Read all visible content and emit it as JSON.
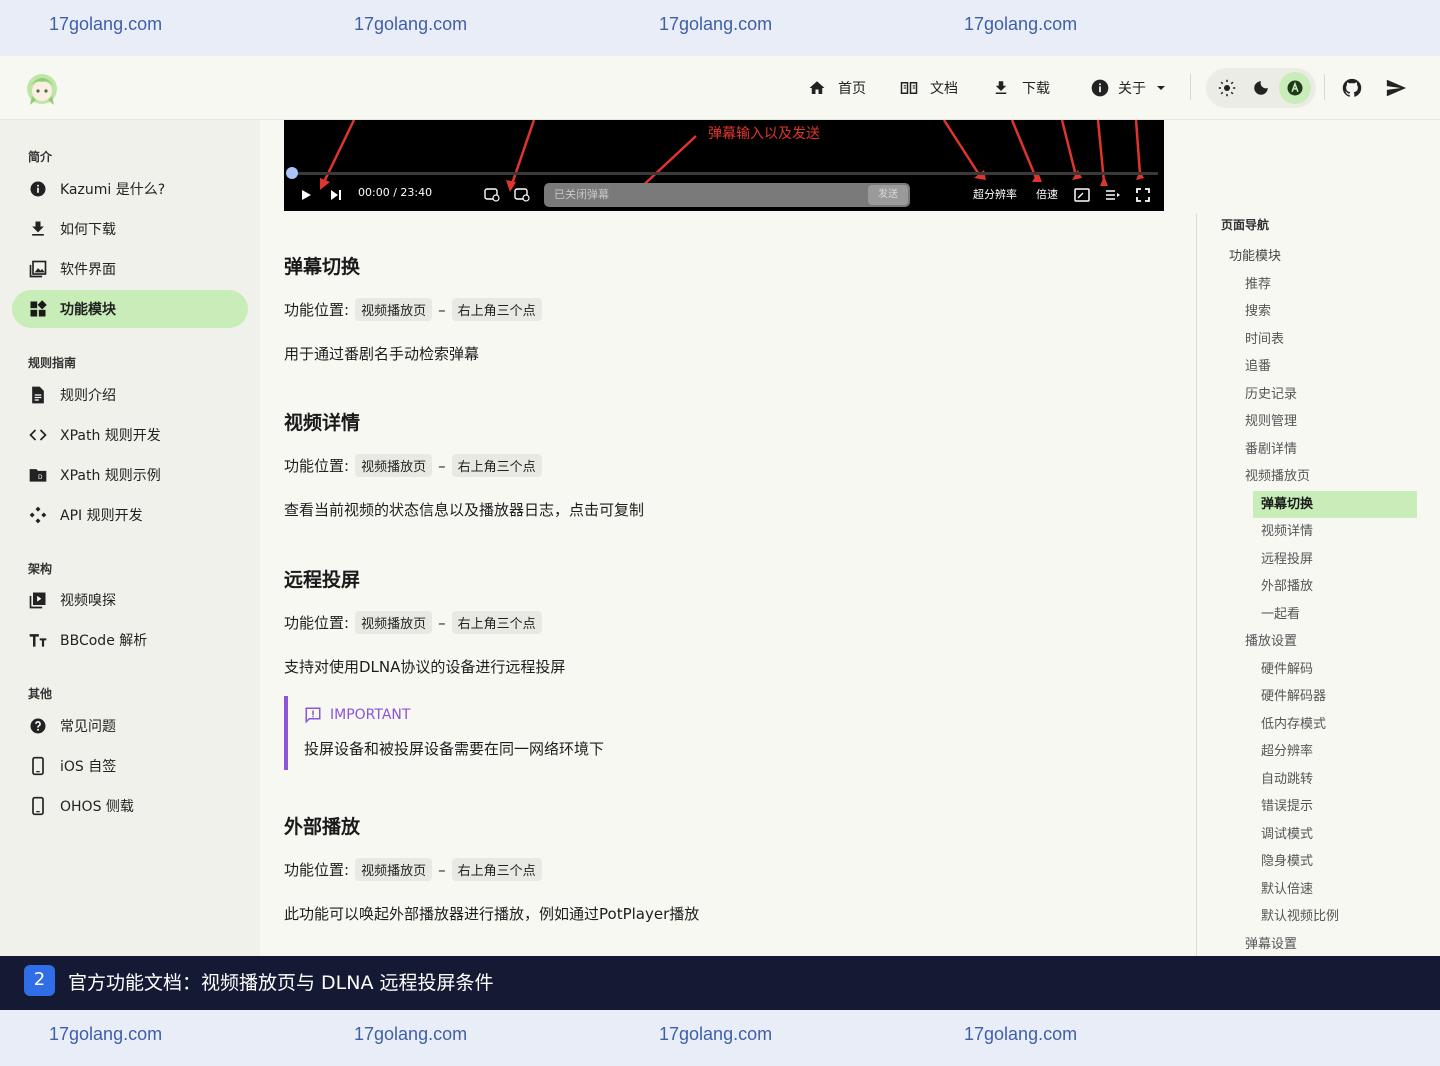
{
  "watermark": {
    "text": "17golang.com"
  },
  "header": {
    "nav": [
      {
        "label": "首页",
        "icon": "home-icon"
      },
      {
        "label": "文档",
        "icon": "book-icon"
      },
      {
        "label": "下载",
        "icon": "download-icon"
      },
      {
        "label": "关于",
        "icon": "info-icon"
      }
    ],
    "theme": {
      "active": "auto",
      "accent": "#c8edb8"
    }
  },
  "sidebar": {
    "sections": [
      {
        "title": "简介",
        "items": [
          {
            "label": "Kazumi 是什么?",
            "icon": "info-icon"
          },
          {
            "label": "如何下载",
            "icon": "download-icon"
          },
          {
            "label": "软件界面",
            "icon": "gallery-icon"
          },
          {
            "label": "功能模块",
            "icon": "widgets-icon",
            "active": true
          }
        ]
      },
      {
        "title": "规则指南",
        "items": [
          {
            "label": "规则介绍",
            "icon": "document-icon"
          },
          {
            "label": "XPath 规则开发",
            "icon": "code-icon"
          },
          {
            "label": "XPath 规则示例",
            "icon": "folder-icon"
          },
          {
            "label": "API 规则开发",
            "icon": "api-icon"
          }
        ]
      },
      {
        "title": "架构",
        "items": [
          {
            "label": "视频嗅探",
            "icon": "video-library-icon"
          },
          {
            "label": "BBCode 解析",
            "icon": "text-format-icon"
          }
        ]
      },
      {
        "title": "其他",
        "items": [
          {
            "label": "常见问题",
            "icon": "help-icon"
          },
          {
            "label": "iOS 自签",
            "icon": "phone-icon"
          },
          {
            "label": "OHOS 侧载",
            "icon": "phone-icon"
          }
        ]
      }
    ]
  },
  "player": {
    "caption": "弹幕输入以及发送",
    "time": "00:00 / 23:40",
    "danmaku_placeholder": "已关闭弹幕",
    "send_label": "发送",
    "super_resolution": "超分辨率",
    "speed": "倍速"
  },
  "content": {
    "location_label": "功能位置:",
    "location_path": [
      "视频播放页",
      "右上角三个点"
    ],
    "location_sep": "–",
    "sections": [
      {
        "heading": "弹幕切换",
        "desc": "用于通过番剧名手动检索弹幕"
      },
      {
        "heading": "视频详情",
        "desc": "查看当前视频的状态信息以及播放器日志，点击可复制"
      },
      {
        "heading": "远程投屏",
        "desc": "支持对使用DLNA协议的设备进行远程投屏"
      },
      {
        "heading": "外部播放",
        "desc": "此功能可以唤起外部播放器进行播放，例如通过PotPlayer播放"
      }
    ],
    "callout": {
      "title": "IMPORTANT",
      "body": "投屏设备和被投屏设备需要在同一网络环境下",
      "color": "#8a55d8"
    }
  },
  "toc": {
    "title": "页面导航",
    "items": [
      {
        "label": "功能模块",
        "level": 1
      },
      {
        "label": "推荐",
        "level": 2
      },
      {
        "label": "搜索",
        "level": 2
      },
      {
        "label": "时间表",
        "level": 2
      },
      {
        "label": "追番",
        "level": 2
      },
      {
        "label": "历史记录",
        "level": 2
      },
      {
        "label": "规则管理",
        "level": 2
      },
      {
        "label": "番剧详情",
        "level": 2
      },
      {
        "label": "视频播放页",
        "level": 2
      },
      {
        "label": "弹幕切换",
        "level": 3,
        "active": true
      },
      {
        "label": "视频详情",
        "level": 3
      },
      {
        "label": "远程投屏",
        "level": 3
      },
      {
        "label": "外部播放",
        "level": 3
      },
      {
        "label": "一起看",
        "level": 3
      },
      {
        "label": "播放设置",
        "level": 2
      },
      {
        "label": "硬件解码",
        "level": 3
      },
      {
        "label": "硬件解码器",
        "level": 3
      },
      {
        "label": "低内存模式",
        "level": 3
      },
      {
        "label": "超分辨率",
        "level": 3
      },
      {
        "label": "自动跳转",
        "level": 3
      },
      {
        "label": "错误提示",
        "level": 3
      },
      {
        "label": "调试模式",
        "level": 3
      },
      {
        "label": "隐身模式",
        "level": 3
      },
      {
        "label": "默认倍速",
        "level": 3
      },
      {
        "label": "默认视频比例",
        "level": 3
      },
      {
        "label": "弹幕设置",
        "level": 2
      }
    ]
  },
  "banner": {
    "number": "2",
    "text": "官方功能文档：视频播放页与 DLNA 远程投屏条件",
    "badge_color": "#2f6ee6"
  }
}
